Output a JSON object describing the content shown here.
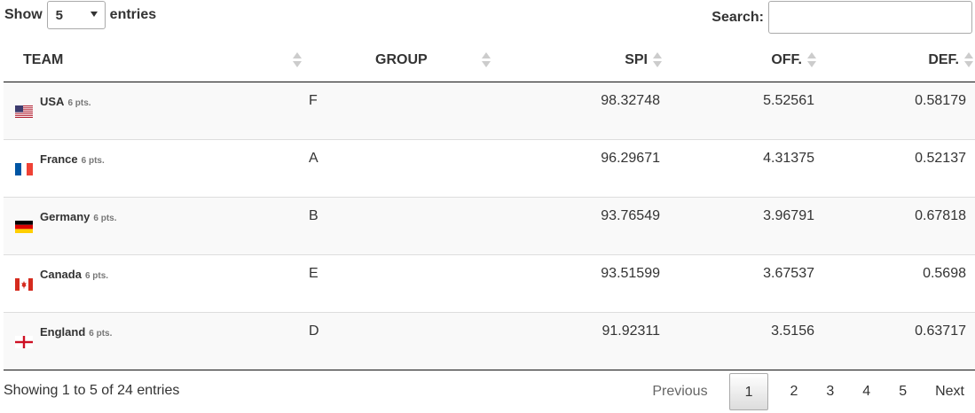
{
  "length_control": {
    "show_label": "Show",
    "selected": "5",
    "entries_label": "entries"
  },
  "search": {
    "label": "Search:",
    "value": ""
  },
  "columns": [
    "TEAM",
    "GROUP",
    "SPI",
    "OFF.",
    "DEF."
  ],
  "rows": [
    {
      "team": "USA",
      "pts": "6 pts.",
      "flag": "usa-flag-icon",
      "group": "F",
      "spi": "98.32748",
      "off": "5.52561",
      "def": "0.58179"
    },
    {
      "team": "France",
      "pts": "6 pts.",
      "flag": "france-flag-icon",
      "group": "A",
      "spi": "96.29671",
      "off": "4.31375",
      "def": "0.52137"
    },
    {
      "team": "Germany",
      "pts": "6 pts.",
      "flag": "germany-flag-icon",
      "group": "B",
      "spi": "93.76549",
      "off": "3.96791",
      "def": "0.67818"
    },
    {
      "team": "Canada",
      "pts": "6 pts.",
      "flag": "canada-flag-icon",
      "group": "E",
      "spi": "93.51599",
      "off": "3.67537",
      "def": "0.5698"
    },
    {
      "team": "England",
      "pts": "6 pts.",
      "flag": "england-flag-icon",
      "group": "D",
      "spi": "91.92311",
      "off": "3.5156",
      "def": "0.63717"
    }
  ],
  "info": "Showing 1 to 5 of 24 entries",
  "pagination": {
    "previous": "Previous",
    "pages": [
      "1",
      "2",
      "3",
      "4",
      "5"
    ],
    "current": "1",
    "next": "Next"
  }
}
